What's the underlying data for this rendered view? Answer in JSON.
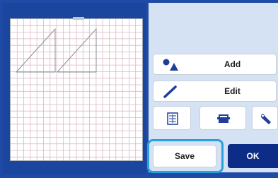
{
  "buttons": {
    "add_label": "Add",
    "edit_label": "Edit",
    "save_label": "Save",
    "ok_label": "OK"
  },
  "icons": {
    "add": "shapes-icon",
    "edit": "pen-icon",
    "tool1": "pattern-layout-icon",
    "tool2": "mat-scan-icon",
    "tool3": "wrench-icon"
  },
  "colors": {
    "screen_blue": "#1f4ba6",
    "panel_light": "#d5e2f3",
    "ok_blue": "#0d2c86",
    "focus_ring": "#2aa0dc",
    "grid_line": "#d9b9c4"
  }
}
